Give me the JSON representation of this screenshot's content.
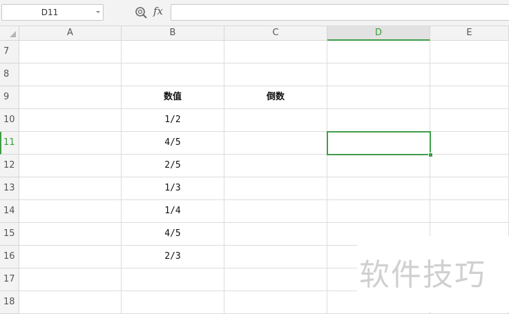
{
  "formula_bar": {
    "name_box": "D11",
    "fx": "fx",
    "formula": ""
  },
  "columns": [
    "A",
    "B",
    "C",
    "D",
    "E"
  ],
  "active_column": "D",
  "rows": [
    {
      "num": "7",
      "A": "",
      "B": "",
      "C": "",
      "D": ""
    },
    {
      "num": "8",
      "A": "",
      "B": "",
      "C": "",
      "D": ""
    },
    {
      "num": "9",
      "A": "",
      "B": "数值",
      "C": "倒数",
      "D": ""
    },
    {
      "num": "10",
      "A": "",
      "B": "1/2",
      "C": "",
      "D": ""
    },
    {
      "num": "11",
      "A": "",
      "B": "4/5",
      "C": "",
      "D": ""
    },
    {
      "num": "12",
      "A": "",
      "B": "2/5",
      "C": "",
      "D": ""
    },
    {
      "num": "13",
      "A": "",
      "B": "1/3",
      "C": "",
      "D": ""
    },
    {
      "num": "14",
      "A": "",
      "B": "1/4",
      "C": "",
      "D": ""
    },
    {
      "num": "15",
      "A": "",
      "B": "4/5",
      "C": "",
      "D": ""
    },
    {
      "num": "16",
      "A": "",
      "B": "2/3",
      "C": "",
      "D": ""
    },
    {
      "num": "17",
      "A": "",
      "B": "",
      "C": "",
      "D": ""
    },
    {
      "num": "18",
      "A": "",
      "B": "",
      "C": "",
      "D": ""
    }
  ],
  "active_row": "11",
  "watermark": "软件技巧",
  "colors": {
    "accent": "#3f9d47",
    "header_bg": "#f3f3f3",
    "grid": "#dcdcdc"
  }
}
